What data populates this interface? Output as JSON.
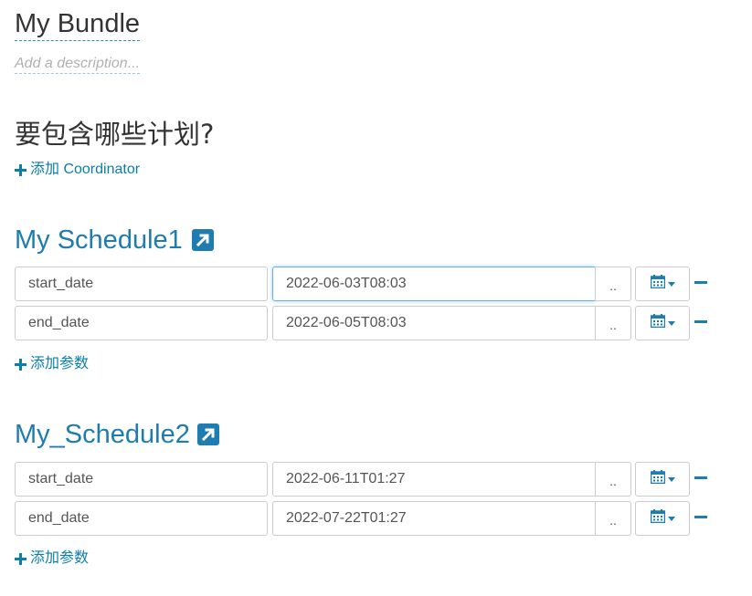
{
  "bundle": {
    "title": "My Bundle",
    "description_placeholder": "Add a description..."
  },
  "question": "要包含哪些计划?",
  "add_coordinator_label": "添加 Coordinator",
  "add_param_label": "添加参数",
  "dots_label": "..",
  "schedules": [
    {
      "title": "My Schedule1",
      "params": [
        {
          "name": "start_date",
          "value": "2022-06-03T08:03"
        },
        {
          "name": "end_date",
          "value": "2022-06-05T08:03"
        }
      ]
    },
    {
      "title": "My_Schedule2",
      "params": [
        {
          "name": "start_date",
          "value": "2022-06-11T01:27"
        },
        {
          "name": "end_date",
          "value": "2022-07-22T01:27"
        }
      ]
    }
  ],
  "colors": {
    "accent": "#1e7cb0",
    "link": "#0b7fab",
    "border": "#cccccc"
  },
  "icons": [
    "external-link-icon",
    "calendar-icon",
    "caret-down-icon",
    "plus-icon",
    "minus-icon"
  ]
}
